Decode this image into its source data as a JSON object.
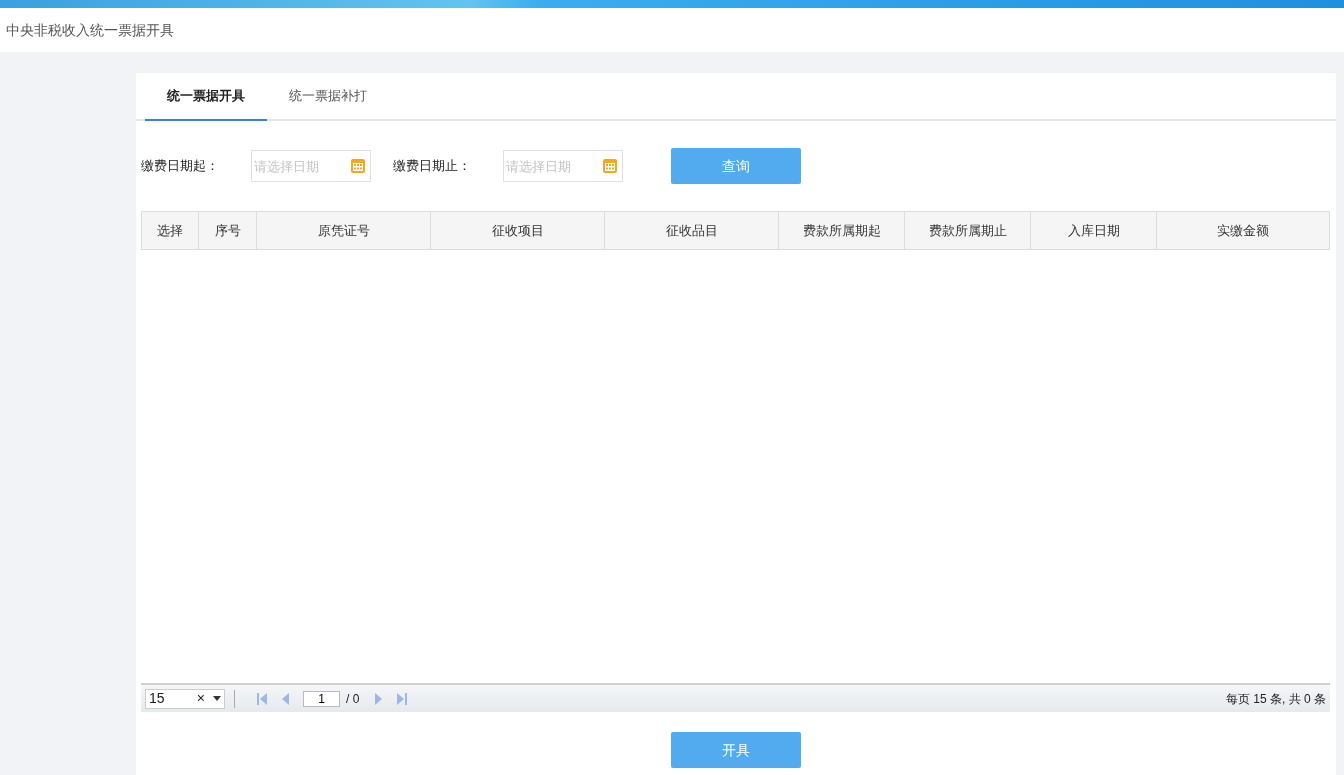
{
  "header": {
    "title": "中央非税收入统一票据开具"
  },
  "tabs": [
    {
      "label": "统一票据开具",
      "selected": true
    },
    {
      "label": "统一票据补打",
      "selected": false
    }
  ],
  "filters": [
    {
      "label": "缴费日期起：",
      "placeholder": "请选择日期"
    },
    {
      "label": "缴费日期止：",
      "placeholder": "请选择日期"
    }
  ],
  "query_button": "查询",
  "table": {
    "columns": [
      "选择",
      "序号",
      "原凭证号",
      "征收项目",
      "征收品目",
      "费款所属期起",
      "费款所属期止",
      "入库日期",
      "实缴金额"
    ]
  },
  "pager": {
    "page_size": "15",
    "clear": "×",
    "page": "1",
    "total_pages": "/ 0",
    "summary": "每页 15 条, 共 0 条"
  },
  "issue_button": "开具"
}
